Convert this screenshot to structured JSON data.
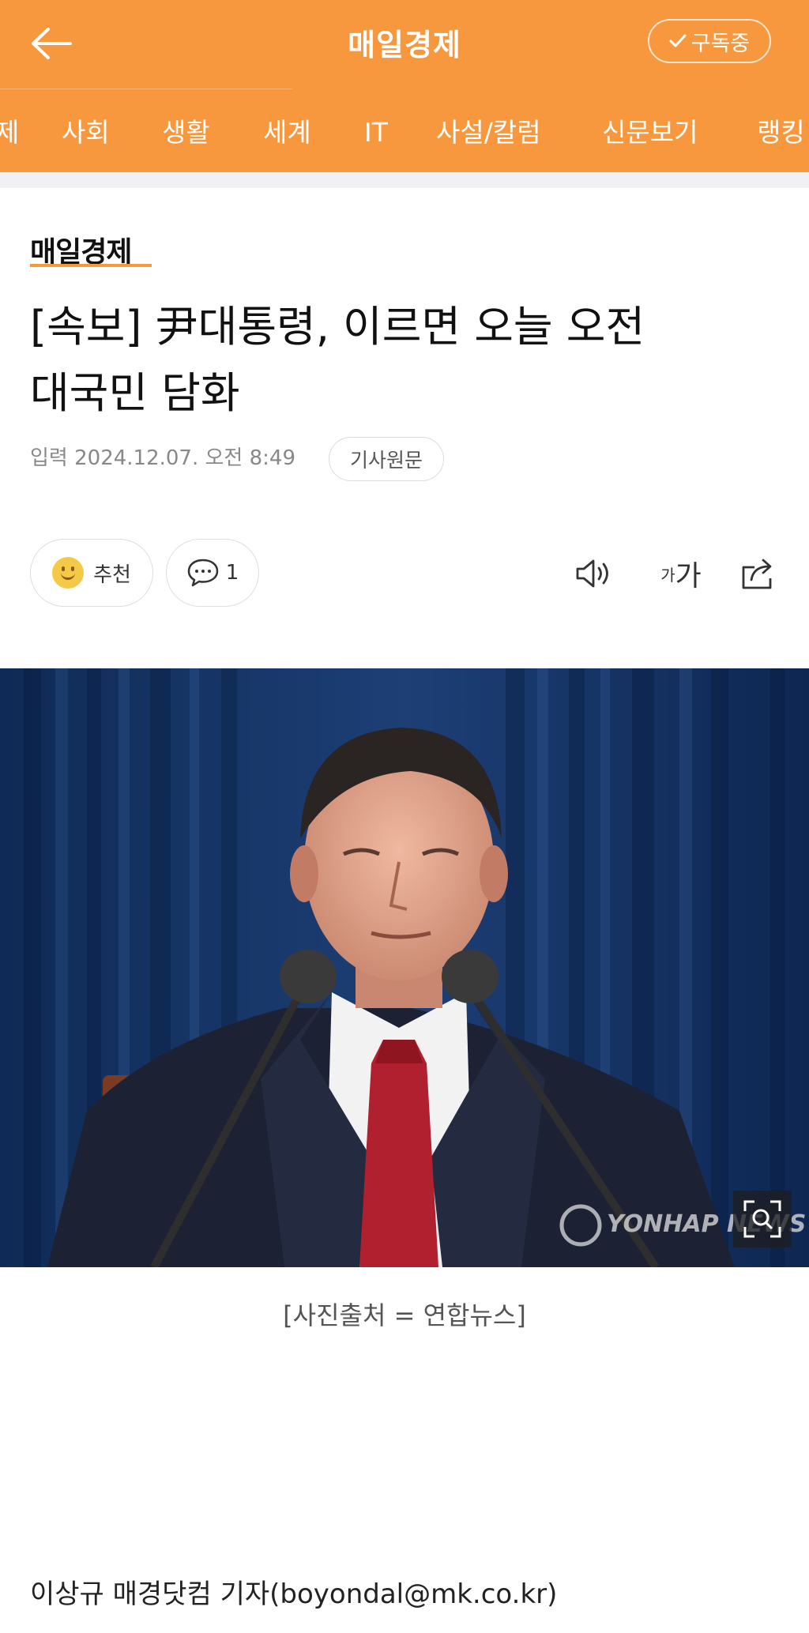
{
  "header": {
    "title": "매일경제",
    "subscribe_label": "구독중",
    "back_icon": "arrow-left-icon"
  },
  "nav": {
    "items": [
      "제",
      "사회",
      "생활",
      "세계",
      "IT",
      "사설/칼럼",
      "신문보기",
      "랭킹"
    ]
  },
  "article": {
    "press_logo": "매일경제",
    "headline_line1": "[속보] 尹대통령, 이르면 오늘 오전",
    "headline_line2": "대국민 담화",
    "published": "입력 2024.12.07. 오전 8:49",
    "original_label": "기사원문",
    "recommend_label": "추천",
    "comment_count": "1",
    "font_small": "가",
    "font_large": "가",
    "photo_watermark": "YONHAP NEWS",
    "caption": "[사진출처 = 연합뉴스]",
    "byline": "이상규 매경닷컴 기자(boyondal@mk.co.kr)"
  },
  "colors": {
    "brand": "#f7983f",
    "text": "#111111",
    "muted": "#888888"
  }
}
